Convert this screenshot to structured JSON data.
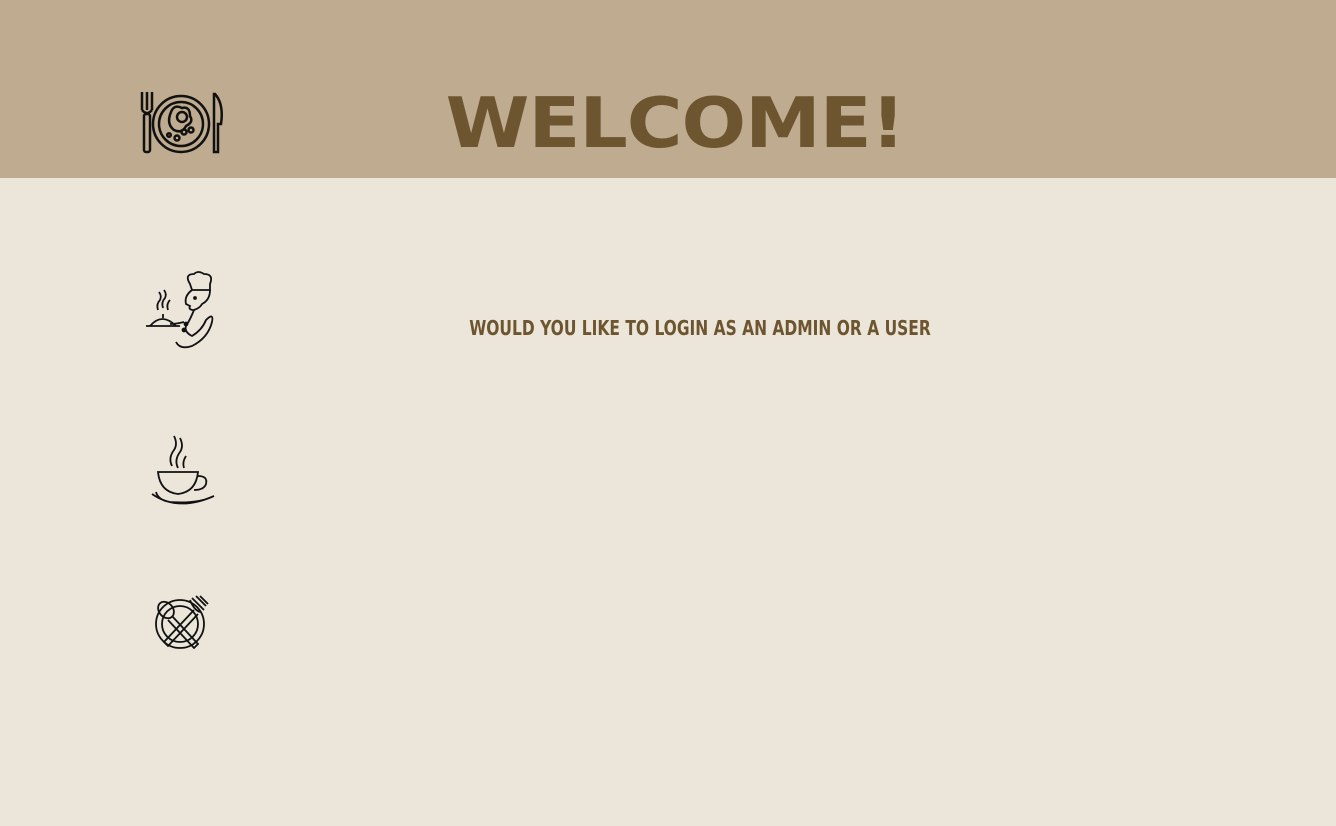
{
  "header": {
    "title": "WELCOME!",
    "logo_icon": "plate-cutlery-icon"
  },
  "main": {
    "prompt": "WOULD YOU LIKE TO LOGIN AS AN ADMIN OR A USER"
  },
  "sidebar_icons": [
    {
      "name": "chef-icon"
    },
    {
      "name": "coffee-cup-icon"
    },
    {
      "name": "plate-spoon-fork-icon"
    }
  ],
  "colors": {
    "header_bg": "#bfab8f",
    "page_bg": "#ebe5da",
    "accent_text": "#6d5530"
  }
}
